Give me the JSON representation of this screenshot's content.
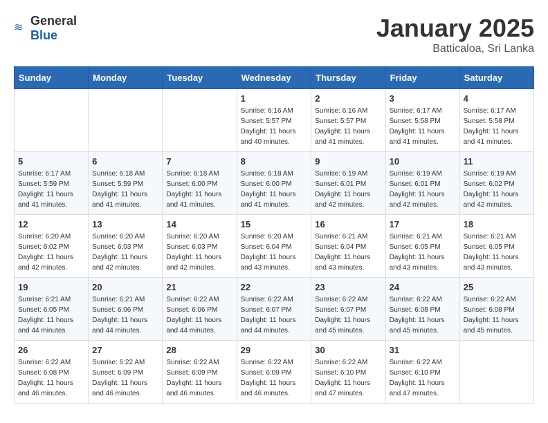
{
  "header": {
    "logo_general": "General",
    "logo_blue": "Blue",
    "month_year": "January 2025",
    "location": "Batticaloa, Sri Lanka"
  },
  "days_of_week": [
    "Sunday",
    "Monday",
    "Tuesday",
    "Wednesday",
    "Thursday",
    "Friday",
    "Saturday"
  ],
  "weeks": [
    [
      {
        "day": "",
        "info": ""
      },
      {
        "day": "",
        "info": ""
      },
      {
        "day": "",
        "info": ""
      },
      {
        "day": "1",
        "info": "Sunrise: 6:16 AM\nSunset: 5:57 PM\nDaylight: 11 hours and 40 minutes."
      },
      {
        "day": "2",
        "info": "Sunrise: 6:16 AM\nSunset: 5:57 PM\nDaylight: 11 hours and 41 minutes."
      },
      {
        "day": "3",
        "info": "Sunrise: 6:17 AM\nSunset: 5:58 PM\nDaylight: 11 hours and 41 minutes."
      },
      {
        "day": "4",
        "info": "Sunrise: 6:17 AM\nSunset: 5:58 PM\nDaylight: 11 hours and 41 minutes."
      }
    ],
    [
      {
        "day": "5",
        "info": "Sunrise: 6:17 AM\nSunset: 5:59 PM\nDaylight: 11 hours and 41 minutes."
      },
      {
        "day": "6",
        "info": "Sunrise: 6:18 AM\nSunset: 5:59 PM\nDaylight: 11 hours and 41 minutes."
      },
      {
        "day": "7",
        "info": "Sunrise: 6:18 AM\nSunset: 6:00 PM\nDaylight: 11 hours and 41 minutes."
      },
      {
        "day": "8",
        "info": "Sunrise: 6:18 AM\nSunset: 6:00 PM\nDaylight: 11 hours and 41 minutes."
      },
      {
        "day": "9",
        "info": "Sunrise: 6:19 AM\nSunset: 6:01 PM\nDaylight: 11 hours and 42 minutes."
      },
      {
        "day": "10",
        "info": "Sunrise: 6:19 AM\nSunset: 6:01 PM\nDaylight: 11 hours and 42 minutes."
      },
      {
        "day": "11",
        "info": "Sunrise: 6:19 AM\nSunset: 6:02 PM\nDaylight: 11 hours and 42 minutes."
      }
    ],
    [
      {
        "day": "12",
        "info": "Sunrise: 6:20 AM\nSunset: 6:02 PM\nDaylight: 11 hours and 42 minutes."
      },
      {
        "day": "13",
        "info": "Sunrise: 6:20 AM\nSunset: 6:03 PM\nDaylight: 11 hours and 42 minutes."
      },
      {
        "day": "14",
        "info": "Sunrise: 6:20 AM\nSunset: 6:03 PM\nDaylight: 11 hours and 42 minutes."
      },
      {
        "day": "15",
        "info": "Sunrise: 6:20 AM\nSunset: 6:04 PM\nDaylight: 11 hours and 43 minutes."
      },
      {
        "day": "16",
        "info": "Sunrise: 6:21 AM\nSunset: 6:04 PM\nDaylight: 11 hours and 43 minutes."
      },
      {
        "day": "17",
        "info": "Sunrise: 6:21 AM\nSunset: 6:05 PM\nDaylight: 11 hours and 43 minutes."
      },
      {
        "day": "18",
        "info": "Sunrise: 6:21 AM\nSunset: 6:05 PM\nDaylight: 11 hours and 43 minutes."
      }
    ],
    [
      {
        "day": "19",
        "info": "Sunrise: 6:21 AM\nSunset: 6:05 PM\nDaylight: 11 hours and 44 minutes."
      },
      {
        "day": "20",
        "info": "Sunrise: 6:21 AM\nSunset: 6:06 PM\nDaylight: 11 hours and 44 minutes."
      },
      {
        "day": "21",
        "info": "Sunrise: 6:22 AM\nSunset: 6:06 PM\nDaylight: 11 hours and 44 minutes."
      },
      {
        "day": "22",
        "info": "Sunrise: 6:22 AM\nSunset: 6:07 PM\nDaylight: 11 hours and 44 minutes."
      },
      {
        "day": "23",
        "info": "Sunrise: 6:22 AM\nSunset: 6:07 PM\nDaylight: 11 hours and 45 minutes."
      },
      {
        "day": "24",
        "info": "Sunrise: 6:22 AM\nSunset: 6:08 PM\nDaylight: 11 hours and 45 minutes."
      },
      {
        "day": "25",
        "info": "Sunrise: 6:22 AM\nSunset: 6:08 PM\nDaylight: 11 hours and 45 minutes."
      }
    ],
    [
      {
        "day": "26",
        "info": "Sunrise: 6:22 AM\nSunset: 6:08 PM\nDaylight: 11 hours and 46 minutes."
      },
      {
        "day": "27",
        "info": "Sunrise: 6:22 AM\nSunset: 6:09 PM\nDaylight: 11 hours and 46 minutes."
      },
      {
        "day": "28",
        "info": "Sunrise: 6:22 AM\nSunset: 6:09 PM\nDaylight: 11 hours and 46 minutes."
      },
      {
        "day": "29",
        "info": "Sunrise: 6:22 AM\nSunset: 6:09 PM\nDaylight: 11 hours and 46 minutes."
      },
      {
        "day": "30",
        "info": "Sunrise: 6:22 AM\nSunset: 6:10 PM\nDaylight: 11 hours and 47 minutes."
      },
      {
        "day": "31",
        "info": "Sunrise: 6:22 AM\nSunset: 6:10 PM\nDaylight: 11 hours and 47 minutes."
      },
      {
        "day": "",
        "info": ""
      }
    ]
  ]
}
